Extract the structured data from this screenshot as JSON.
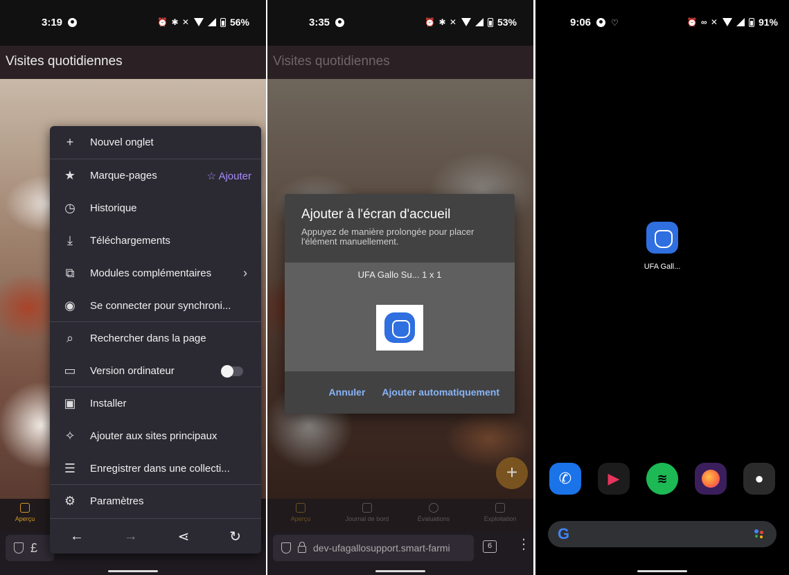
{
  "screens": {
    "menu_screen": {
      "status": {
        "time": "3:19",
        "battery": "56%"
      },
      "app_title": "Visites quotidiennes",
      "menu_items": [
        {
          "label": "Nouvel onglet"
        },
        {
          "label": "Marque-pages",
          "action": "Ajouter"
        },
        {
          "label": "Historique"
        },
        {
          "label": "Téléchargements"
        },
        {
          "label": "Modules complémentaires"
        },
        {
          "label": "Se connecter pour synchroni..."
        },
        {
          "label": "Rechercher dans la page"
        },
        {
          "label": "Version ordinateur",
          "toggle_on": false
        },
        {
          "label": "Installer"
        },
        {
          "label": "Ajouter aux sites principaux"
        },
        {
          "label": "Enregistrer dans une collecti..."
        },
        {
          "label": "Paramètres"
        }
      ],
      "nav_active_label": "Aperçu",
      "url_prefix": "£"
    },
    "dialog_screen": {
      "status": {
        "time": "3:35",
        "battery": "53%"
      },
      "app_title": "Visites quotidiennes",
      "dialog": {
        "title": "Ajouter à l'écran d'accueil",
        "subtitle": "Appuyez de manière prolongée pour placer l'élément manuellement.",
        "preview_label": "UFA Gallo Su...  1 x 1",
        "cancel": "Annuler",
        "confirm": "Ajouter automatiquement"
      },
      "nav": [
        "Aperçu",
        "Journal de bord",
        "Évaluations",
        "Exploitation"
      ],
      "url": "dev-ufagallosupport.smart-farmi",
      "tab_count": "6"
    },
    "home_screen": {
      "status": {
        "time": "9:06",
        "battery": "91%"
      },
      "app_label": "UFA Gall...",
      "search_logo": "G"
    }
  },
  "colors": {
    "accent_purple": "#a78bfa",
    "link_blue": "#8ab4f8",
    "nav_active": "#d29a27",
    "app_blue": "#2f6fe0"
  }
}
